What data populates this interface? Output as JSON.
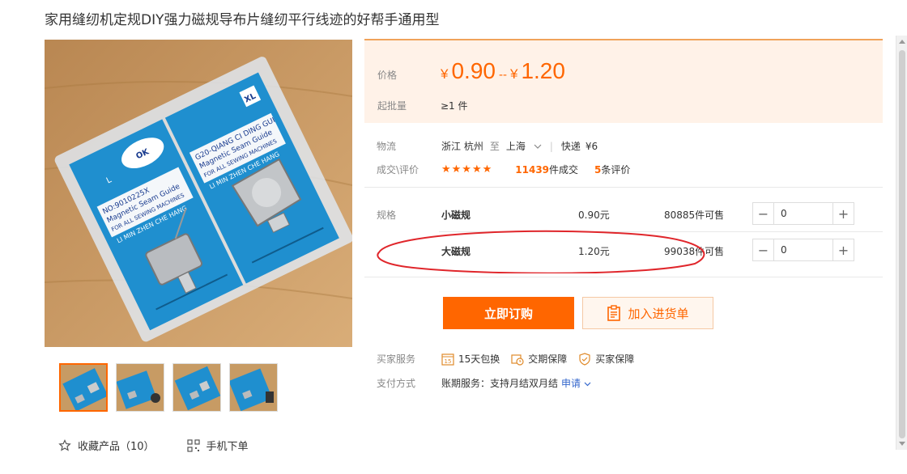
{
  "product": {
    "title": "家用缝纫机定规DIY强力磁规导布片缝纫平行线迹的好帮手通用型"
  },
  "price": {
    "label": "价格",
    "currency": "¥",
    "low": "0.90",
    "dash": "--",
    "high": "1.20",
    "moq_label": "起批量",
    "moq_value": "≥1 件"
  },
  "shipping": {
    "label": "物流",
    "from": "浙江 杭州",
    "to_word": "至",
    "to": "上海",
    "express": "快递",
    "fee": "¥6"
  },
  "deals": {
    "label": "成交\\评价",
    "stars": "★★★★★",
    "sold_count": "11439",
    "sold_suffix": "件成交",
    "review_count": "5",
    "review_suffix": "条评价"
  },
  "specs": {
    "label": "规格",
    "rows": [
      {
        "name": "小磁规",
        "price": "0.90元",
        "stock": "80885件可售",
        "qty": "0"
      },
      {
        "name": "大磁规",
        "price": "1.20元",
        "stock": "99038件可售",
        "qty": "0"
      }
    ]
  },
  "actions": {
    "buy_label": "立即订购",
    "cart_label": "加入进货单"
  },
  "services": {
    "label": "买家服务",
    "items": [
      "15天包换",
      "交期保障",
      "买家保障"
    ],
    "badge_15": "15"
  },
  "payment": {
    "label": "支付方式",
    "value": "账期服务：支持月结双月结",
    "apply": "申请"
  },
  "bottom": {
    "favorite": "收藏产品（10）",
    "mobile": "手机下单"
  },
  "image": {
    "left_card_lines": [
      "NO:9010225X",
      "Magnetic Seam Guide",
      "FOR ALL SEWING MACHINES",
      "LI MIN ZHEN CHE HANG"
    ],
    "right_card_lines": [
      "G20-QIANG CI DING GUI",
      "Magnetic Seam Guide",
      "FOR ALL SEWING MACHINES",
      "LI MIN ZHEN CHE HANG"
    ],
    "ok_badge": "OK",
    "size_s": "L",
    "size_xl": "XL"
  },
  "colors": {
    "accent": "#ff6600",
    "price_bg": "#fff2e8",
    "link": "#3366cc",
    "annotation": "#e0262b"
  }
}
